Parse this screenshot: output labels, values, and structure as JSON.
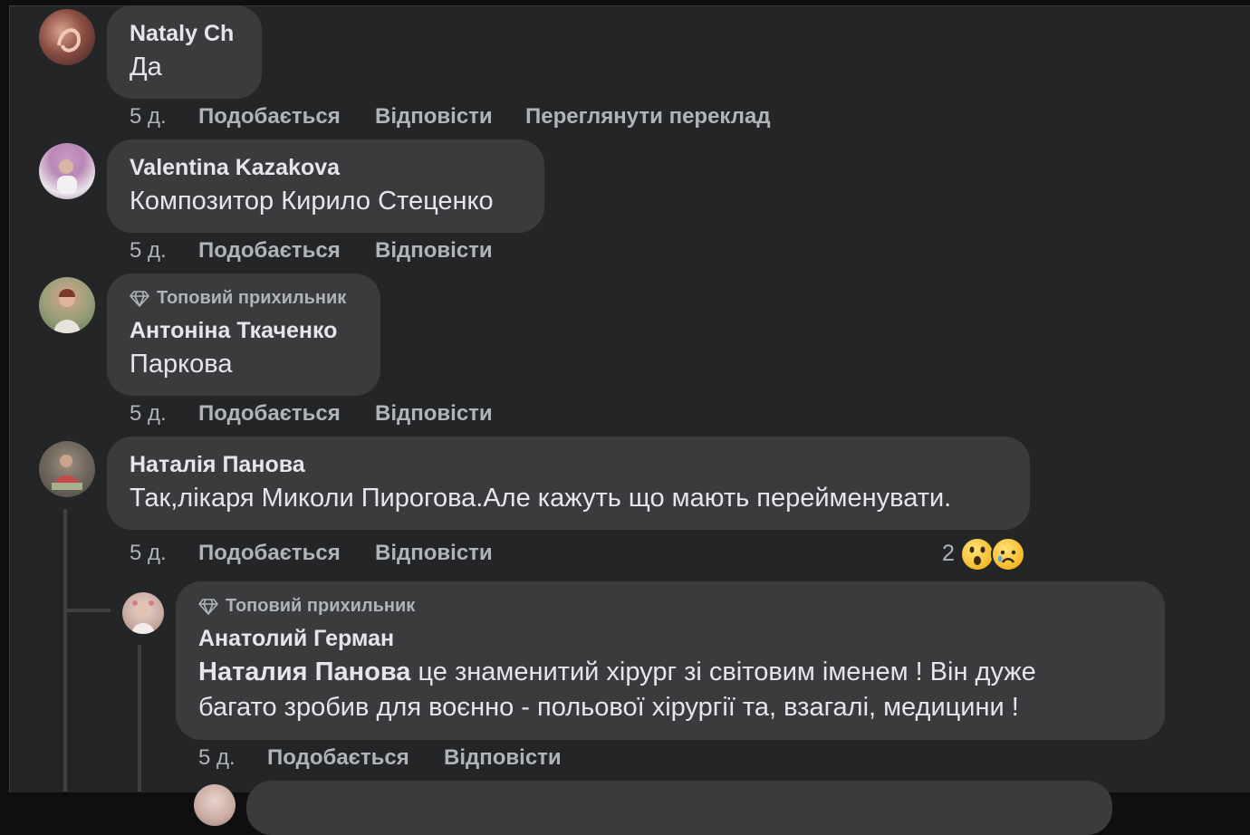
{
  "comments": [
    {
      "author": "Nataly Ch",
      "text": "Да",
      "time": "5 д.",
      "like": "Подобається",
      "reply": "Відповісти",
      "translate": "Переглянути переклад"
    },
    {
      "author": "Valentina Kazakova",
      "text": "Композитор Кирило Стеценко",
      "time": "5 д.",
      "like": "Подобається",
      "reply": "Відповісти"
    },
    {
      "badge": "Топовий прихильник",
      "author": "Антоніна Ткаченко",
      "text": "Паркова",
      "time": "5 д.",
      "like": "Подобається",
      "reply": "Відповісти"
    },
    {
      "author": "Наталія Панова",
      "text": "Так,лікаря Миколи Пирогова.Але кажуть що мають перейменувати.",
      "time": "5 д.",
      "like": "Подобається",
      "reply": "Відповісти",
      "reaction_count": "2",
      "reactions": [
        "wow-emoji",
        "sad-emoji"
      ]
    }
  ],
  "reply": {
    "badge": "Топовий прихильник",
    "author": "Анатолий Герман",
    "mention": "Наталия Панова",
    "line1": " це знаменитий хірург зі світовим іменем ! Він дуже",
    "line2": "багато зробив для воєнно - польової хірургії та, взагалі, медицини !",
    "time": "5 д.",
    "like": "Подобається",
    "reply": "Відповісти"
  },
  "colors": {
    "background": "#242526",
    "bubble": "#3a3b3c",
    "primary_text": "#e4e6eb",
    "secondary_text": "#b0b3b8"
  }
}
